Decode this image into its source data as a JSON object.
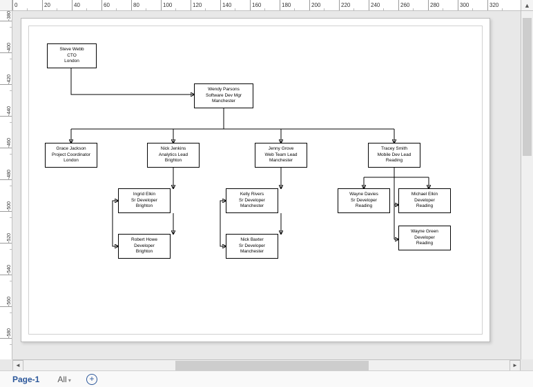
{
  "ruler": {
    "h_labels": [
      "0",
      "20",
      "40",
      "60",
      "80",
      "100",
      "120",
      "140",
      "160",
      "180",
      "200",
      "220",
      "240",
      "260",
      "280",
      "300",
      "320"
    ],
    "v_labels": [
      "-380",
      "-400",
      "-420",
      "-440",
      "-460",
      "-480",
      "-500",
      "-520",
      "-540",
      "-560",
      "-580"
    ]
  },
  "tabs": {
    "page1": "Page-1",
    "all": "All"
  },
  "org": {
    "cto": {
      "name": "Steve Webb",
      "title": "CTO",
      "loc": "London"
    },
    "mgr": {
      "name": "Wendy Parsons",
      "title": "Software Dev Mgr",
      "loc": "Manchester"
    },
    "pc": {
      "name": "Grace Jackson",
      "title": "Project Coordinator",
      "loc": "London"
    },
    "al": {
      "name": "Nick Jenkins",
      "title": "Analytics Lead",
      "loc": "Brighton"
    },
    "wtl": {
      "name": "Jenny Grove",
      "title": "Web Team Lead",
      "loc": "Manchester"
    },
    "mdl": {
      "name": "Tracey Smith",
      "title": "Mobile Dev Lead",
      "loc": "Reading"
    },
    "d1": {
      "name": "Ingrid Elkin",
      "title": "Sr Developer",
      "loc": "Brighton"
    },
    "d2": {
      "name": "Robert Howe",
      "title": "Developer",
      "loc": "Brighton"
    },
    "d3": {
      "name": "Kelly Rivers",
      "title": "Sr Developer",
      "loc": "Manchester"
    },
    "d4": {
      "name": "Nick Baxter",
      "title": "Sr Developer",
      "loc": "Manchester"
    },
    "d5": {
      "name": "Wayne Davies",
      "title": "Sr Developer",
      "loc": "Reading"
    },
    "d6": {
      "name": "Michael Elkin",
      "title": "Developer",
      "loc": "Reading"
    },
    "d7": {
      "name": "Wayne Green",
      "title": "Developer",
      "loc": "Reading"
    }
  }
}
